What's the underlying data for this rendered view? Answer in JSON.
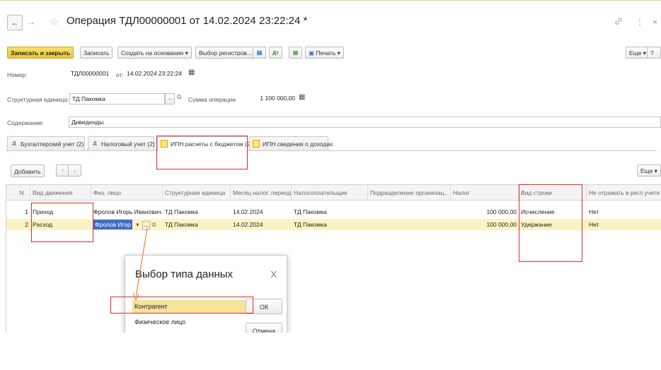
{
  "window": {
    "title": "Операция ТДЛ00000001 от 14.02.2024 23:22:24 *",
    "back_glyph": "←",
    "forward_glyph": "→",
    "star_glyph": "☆",
    "link_glyph": "🔗",
    "menu_glyph": "⋮",
    "close_glyph": "×"
  },
  "toolbar": {
    "save_close": "Записать и закрыть",
    "save": "Записать",
    "create_based": "Создать на основании",
    "registers": "Выбор регистров...",
    "print": "Печать",
    "more": "Еще",
    "help": "?"
  },
  "header": {
    "number_label": "Номер:",
    "number_value": "ТДЛ00000001",
    "date_label": "от:",
    "date_value": "14.02.2024 23:22:24",
    "unit_label": "Структурная единица:",
    "unit_value": "ТД Пакомка",
    "sum_label": "Сумма операции:",
    "sum_value": "1 100 000,00",
    "content_label": "Содержание:",
    "content_value": "Дивиденды"
  },
  "tabs": [
    {
      "label": "Бухгалтерский учет (2)",
      "icon": "dt-kt-icon"
    },
    {
      "label": "Налоговый учет (2)",
      "icon": "dt-kt-tax-icon"
    },
    {
      "label": "ИПН расчеты с бюджетом (2)",
      "icon": "register-icon",
      "active": true
    },
    {
      "label": "ИПН сведения о доходах",
      "icon": "register-icon"
    }
  ],
  "table_toolbar": {
    "add": "Добавить",
    "up_glyph": "↑",
    "down_glyph": "↓",
    "more": "Еще"
  },
  "table": {
    "columns": [
      "N",
      "Вид движения",
      "Физ. лицо",
      "Структурная единица",
      "Месяц налог. периода",
      "Налогоплательщик",
      "Подразделение организац...",
      "Налог",
      "Вид строки",
      "Не отражать в регл учете"
    ],
    "rows": [
      [
        "1",
        "Приход",
        "Фролов Игорь Иванович",
        "ТД Пакомка",
        "14.02.2024",
        "ТД Пакомка",
        "",
        "100 000,00",
        "Исчисление",
        "Нет"
      ],
      [
        "2",
        "Расход",
        "Фролов Игор",
        "ТД Пакомка",
        "14.02.2024",
        "ТД Пакомка",
        "",
        "100 000,00",
        "Удержание",
        "Нет"
      ]
    ]
  },
  "dialog": {
    "title": "Выбор типа данных",
    "close_glyph": "X",
    "items": [
      "Контрагент",
      "Физическое лицо"
    ],
    "ok": "ОК",
    "cancel": "Отмена"
  },
  "colors": {
    "accent_yellow": "#f1d24f",
    "selection_blue": "#3d6ec9",
    "row_highlight": "#fbf3c5",
    "annotation_red": "#e02b2b",
    "annotation_arrow": "#e8843a"
  }
}
